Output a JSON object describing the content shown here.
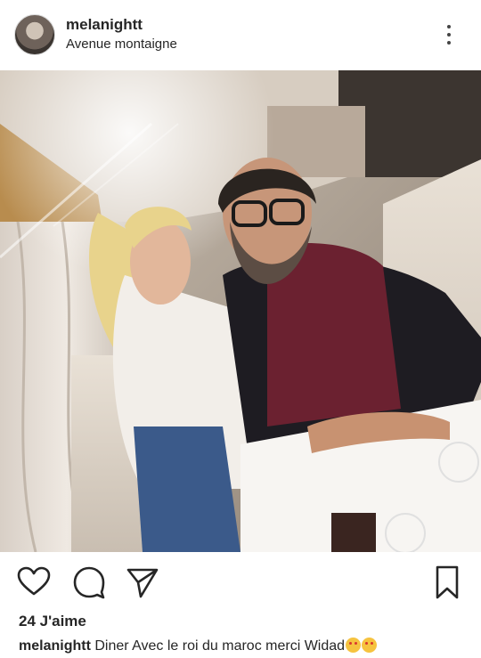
{
  "post": {
    "username": "melanightt",
    "location": "Avenue montaigne",
    "likes_text": "24 J'aime",
    "caption_user": "melanightt",
    "caption_text": "Diner Avec le roi du maroc merci Widad"
  },
  "icons": {
    "more": "more-options-icon",
    "like": "heart-icon",
    "comment": "comment-icon",
    "share": "send-icon",
    "save": "bookmark-icon"
  }
}
